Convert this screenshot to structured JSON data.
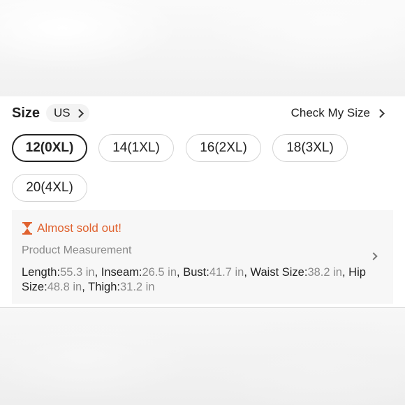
{
  "size_section": {
    "title": "Size",
    "region": "US",
    "check_my_size": "Check My Size"
  },
  "size_options": [
    {
      "label": "12(0XL)",
      "selected": true
    },
    {
      "label": "14(1XL)",
      "selected": false
    },
    {
      "label": "16(2XL)",
      "selected": false
    },
    {
      "label": "18(3XL)",
      "selected": false
    },
    {
      "label": "20(4XL)",
      "selected": false
    }
  ],
  "measurement": {
    "alert_icon": "hourglass-icon",
    "alert_text": "Almost sold out!",
    "alert_color": "#e0622f",
    "title": "Product Measurement",
    "items": [
      {
        "label": "Length:",
        "value": "55.3 in"
      },
      {
        "label": "Inseam:",
        "value": "26.5 in"
      },
      {
        "label": "Bust:",
        "value": "41.7 in"
      },
      {
        "label": "Waist Size:",
        "value": "38.2 in"
      },
      {
        "label": "Hip Size:",
        "value": "48.8 in"
      },
      {
        "label": "Thigh:",
        "value": "31.2 in"
      }
    ]
  }
}
